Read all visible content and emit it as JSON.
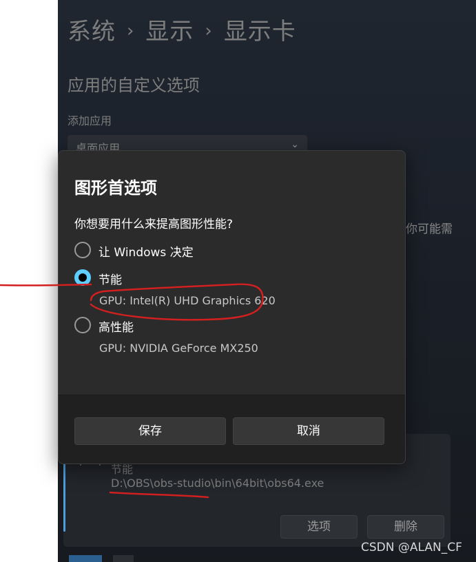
{
  "breadcrumb": {
    "items": [
      "系统",
      "显示",
      "显示卡"
    ],
    "separator": "›"
  },
  "section_title": "应用的自定义选项",
  "add_app_label": "添加应用",
  "app_type_select": {
    "value": "桌面应用",
    "icon": "chevron-down-icon"
  },
  "side_text": "你可能需",
  "app_card": {
    "gpu_label": "节能",
    "path": "D:\\OBS\\obs-studio\\bin\\64bit\\obs64.exe",
    "options_label": "选项",
    "delete_label": "删除"
  },
  "dialog": {
    "title": "图形首选项",
    "question": "你想要用什么来提高图形性能?",
    "options": [
      {
        "label": "让 Windows 决定",
        "sub": "",
        "checked": false
      },
      {
        "label": "节能",
        "sub": "GPU: Intel(R) UHD Graphics 620",
        "checked": true
      },
      {
        "label": "高性能",
        "sub": "GPU: NVIDIA GeForce MX250",
        "checked": false
      }
    ],
    "save_label": "保存",
    "cancel_label": "取消"
  },
  "watermark": "CSDN @ALAN_CF",
  "colors": {
    "accent": "#60cdff",
    "annotation": "#d21f1f",
    "card_accent": "#4ca0e0"
  }
}
